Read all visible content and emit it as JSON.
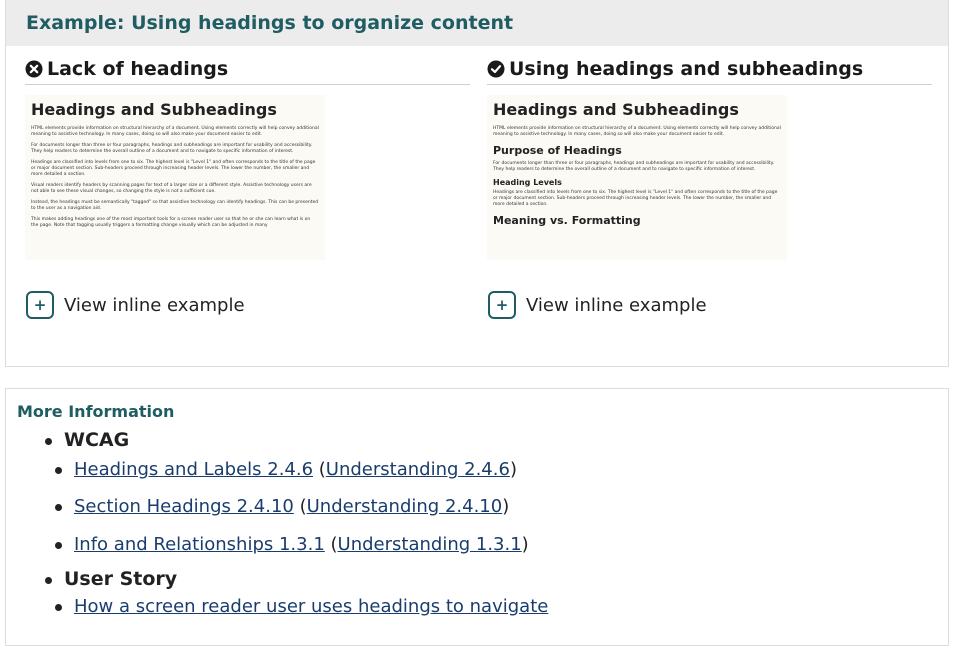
{
  "example": {
    "title": "Example: Using headings to organize content",
    "left": {
      "heading": "Lack of headings",
      "icon": "x-circle-icon",
      "thumb_title": "Headings and Subheadings",
      "thumb_paragraphs": [
        "HTML elements provide information on structural hierarchy of a document. Using elements correctly will help convey additional meaning to assistive technology. In many cases, doing so will also make your document easier to edit.",
        "For documents longer than three or four paragraphs, headings and subheadings are important for usability and accessibility. They help readers to determine the overall outline of a document and to navigate to specific information of interest.",
        "Headings are classified into levels from one to six. The highest level is \"Level 1\" and often corresponds to the title of the page or major document section. Sub-headers proceed through increasing header levels. The lower the number, the smaller and more detailed a section.",
        "Visual readers identify headers by scanning pages for text of a larger size or a different style. Assistive technology users are not able to see these visual changes, so changing the style is not a sufficient cue.",
        "Instead, the headings must be semantically \"tagged\" so that assistive technology can identify headings. This can be presented to the user as a navigation aid.",
        "This makes adding headings one of the most important tools for a screen reader user so that he or she can learn what is on the page. Note that tagging usually triggers a formatting change visually which can be adjusted in many"
      ],
      "toggle_label": "View inline example"
    },
    "right": {
      "heading": "Using headings and subheadings",
      "icon": "check-circle-icon",
      "thumb_title": "Headings and Subheadings",
      "thumb_intro": "HTML elements provide information on structural hierarchy of a document. Using elements correctly will help convey additional meaning to assistive technology. In many cases, doing so will also make your document easier to edit.",
      "thumb_h2": "Purpose of Headings",
      "thumb_p2": "For documents longer than three or four paragraphs, headings and subheadings are important for usability and accessibility. They help readers to determine the overall outline of a document and to navigate to specific information of interest.",
      "thumb_h3": "Heading Levels",
      "thumb_p3": "Headings are classified into levels from one to six. The highest level is \"Level 1\" and often corresponds to the title of the page or major document section. Sub-headers proceed through increasing header levels. The lower the number, the smaller and more detailed a section.",
      "thumb_h2b": "Meaning vs. Formatting",
      "toggle_label": "View inline example"
    },
    "toggle_symbol": "+"
  },
  "more_info": {
    "title": "More Information",
    "wcag": {
      "label": "WCAG",
      "items": [
        {
          "link": "Headings and Labels 2.4.6",
          "open": " (",
          "understanding": "Understanding 2.4.6",
          "close": ")"
        },
        {
          "link": "Section Headings 2.4.10",
          "open": " (",
          "understanding": "Understanding 2.4.10",
          "close": ")"
        },
        {
          "link": "Info and Relationships 1.3.1",
          "open": " (",
          "understanding": "Understanding 1.3.1",
          "close": ")"
        }
      ]
    },
    "user_story": {
      "label": "User Story",
      "link": "How a screen reader user uses headings to navigate"
    }
  },
  "colors": {
    "accent": "#1f5d63",
    "link": "#1a3d6d",
    "header_bg": "#ececec"
  }
}
